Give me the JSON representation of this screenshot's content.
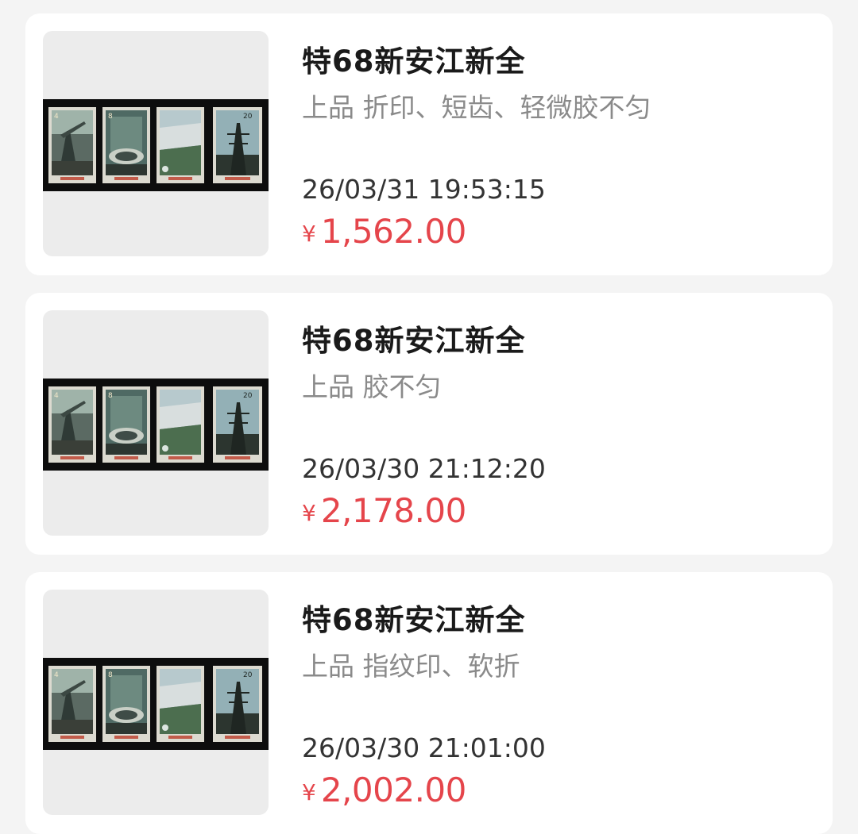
{
  "listings": [
    {
      "title": "特68新安江新全",
      "description": "上品 折印、短齿、轻微胶不匀",
      "timestamp": "26/03/31 19:53:15",
      "currency": "¥",
      "price": "1,562.00"
    },
    {
      "title": "特68新安江新全",
      "description": "上品 胶不匀",
      "timestamp": "26/03/30 21:12:20",
      "currency": "¥",
      "price": "2,178.00"
    },
    {
      "title": "特68新安江新全",
      "description": "上品 指纹印、软折",
      "timestamp": "26/03/30 21:01:00",
      "currency": "¥",
      "price": "2,002.00"
    }
  ],
  "colors": {
    "background": "#f4f4f4",
    "card": "#ffffff",
    "price": "#e5454b",
    "title": "#1a1a1a",
    "description": "#8a8a8a"
  },
  "stamp_denominations": [
    "4",
    "8",
    "",
    "20"
  ]
}
